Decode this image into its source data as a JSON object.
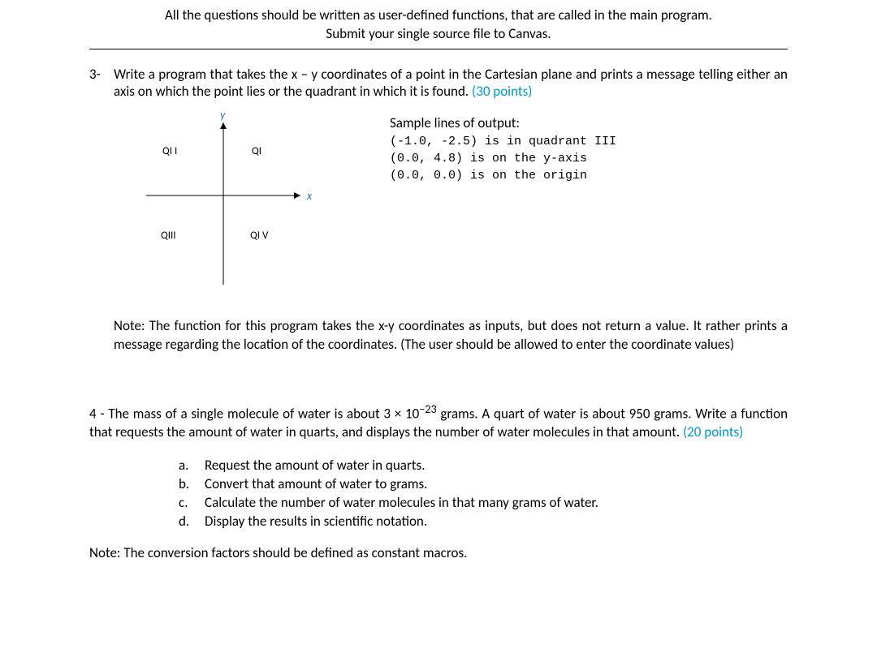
{
  "header": {
    "line1": "All the questions should be written as user-defined functions, that are called in the main program.",
    "line2": "Submit your single source file to Canvas."
  },
  "q3": {
    "number": "3-",
    "text": "Write a program that takes the x – y coordinates of a point in the Cartesian plane and prints a message telling either an axis on which the point lies or the quadrant in which it is found.  ",
    "points": "(30 points)",
    "diagram": {
      "y_label": "y",
      "x_label": "x",
      "q1": "QI",
      "q2": "QI I",
      "q3": "QIII",
      "q4": "QI V"
    },
    "sample_title": "Sample lines of output:",
    "sample_lines": "(-1.0, -2.5) is in quadrant III\n(0.0, 4.8) is on the y-axis\n(0.0, 0.0) is on the origin",
    "note": "Note: The function for this program takes the x-y coordinates as inputs, but does not return a value. It rather prints a message regarding the location of the coordinates. (The user should be allowed to enter the coordinate values)"
  },
  "q4": {
    "intro_prefix": "4 - The mass of a single molecule of water is about 3 × 10",
    "exponent": "−23",
    "intro_suffix": " grams. A quart of water is about 950 grams. Write a function that requests the amount of water in quarts, and displays the number of water molecules in that amount. ",
    "points": "(20 points)",
    "items": {
      "a": {
        "letter": "a.",
        "text": "Request the amount of water in quarts."
      },
      "b": {
        "letter": "b.",
        "text": "Convert that amount of water to grams."
      },
      "c": {
        "letter": "c.",
        "text": "Calculate the number of water molecules in that many grams of water."
      },
      "d": {
        "letter": "d.",
        "text": "Display the results in scientific notation."
      }
    },
    "note": "Note: The conversion factors should be defined as constant macros."
  }
}
